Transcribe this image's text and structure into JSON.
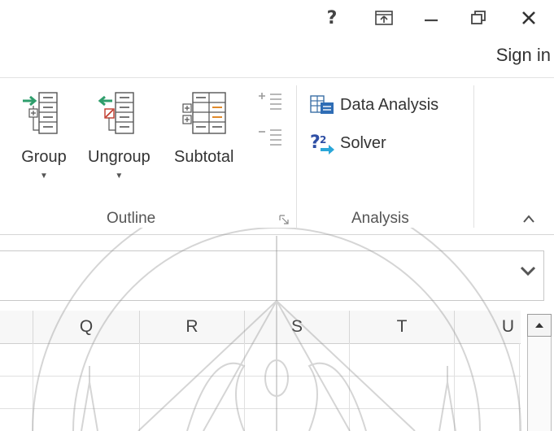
{
  "window": {
    "help_glyph": "?",
    "buttons": [
      "help-icon",
      "ribbon-display-options-icon",
      "minimize-icon",
      "restore-icon",
      "close-icon"
    ],
    "signin_label": "Sign in"
  },
  "ribbon": {
    "outline": {
      "label": "Outline",
      "group_label": "Group",
      "ungroup_label": "Ungroup",
      "subtotal_label": "Subtotal"
    },
    "analysis": {
      "label": "Analysis",
      "data_analysis_label": "Data Analysis",
      "solver_label": "Solver"
    },
    "collapse_glyph": "^"
  },
  "grid": {
    "columns": [
      "Q",
      "R",
      "S",
      "T",
      "U"
    ]
  }
}
